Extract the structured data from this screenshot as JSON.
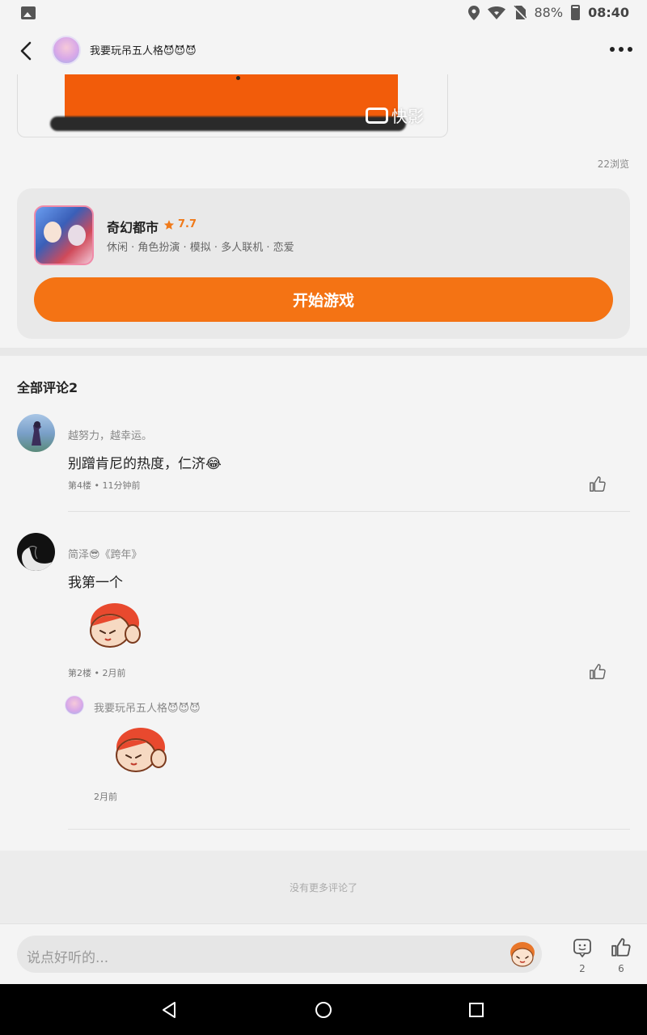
{
  "status_bar": {
    "battery": "88%",
    "time": "08:40",
    "icons": [
      "image-icon",
      "location-icon",
      "wifi-icon",
      "no-sim-icon",
      "battery-icon"
    ]
  },
  "header": {
    "title": "我要玩吊五人格😈😈😈"
  },
  "video": {
    "watermark": "快影"
  },
  "post": {
    "views": "22浏览"
  },
  "game": {
    "name": "奇幻都市",
    "rating": "7.7",
    "tags": "休闲 · 角色扮演 · 模拟 · 多人联机 · 恋爱",
    "play_label": "开始游戏",
    "accent": "#f47314"
  },
  "comments_section": {
    "title": "全部评论2",
    "comments": [
      {
        "user": "越努力，越幸运。",
        "text": "别蹭肯尼的热度，仁济😂",
        "floor": "第4楼",
        "time": "11分钟前"
      },
      {
        "user": "简泽😎《跨年》",
        "text": "我第一个",
        "floor": "第2楼",
        "time": "2月前",
        "reply": {
          "user": "我要玩吊五人格😈😈😈",
          "time": "2月前"
        }
      }
    ],
    "no_more": "没有更多评论了"
  },
  "input_bar": {
    "placeholder": "说点好听的...",
    "comment_count": "2",
    "like_count": "6"
  }
}
